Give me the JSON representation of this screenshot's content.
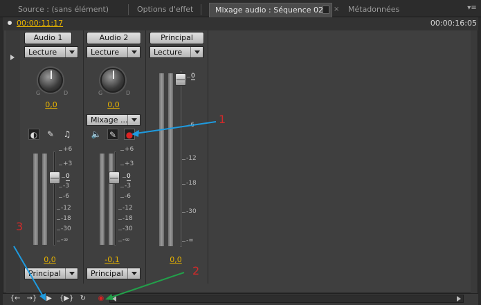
{
  "tabs": [
    {
      "label": "Source : (sans élément)"
    },
    {
      "label": "Options d'effet"
    },
    {
      "label": "Mixage audio : Séquence 02"
    },
    {
      "label": "Métadonnées"
    }
  ],
  "timecode": {
    "current": "00:00:11:17",
    "duration": "00:00:16:05"
  },
  "channels": [
    {
      "name": "Audio 1",
      "mode": "Lecture",
      "knob_left": "G",
      "knob_right": "D",
      "pan_value": "0,0",
      "volume_value": "0,0",
      "output": "Principal"
    },
    {
      "name": "Audio 2",
      "mode": "Lecture",
      "knob_left": "G",
      "knob_right": "D",
      "pan_value": "0,0",
      "effect_dropdown": "Mixage ...",
      "volume_value": "-0,1",
      "output": "Principal"
    },
    {
      "name": "Principal",
      "mode": "Lecture",
      "volume_value": "0,0"
    }
  ],
  "scale_small": [
    "+6",
    "+3",
    "0",
    "-3",
    "-6",
    "-12",
    "-18",
    "-30",
    "-∞"
  ],
  "scale_master": [
    "0",
    "-6",
    "-12",
    "-18",
    "-30",
    "-∞"
  ],
  "annotations": {
    "n1": "1",
    "n2": "2",
    "n3": "3"
  },
  "colors": {
    "accent_time": "#e8b400",
    "record": "#d22222",
    "arrow_blue": "#1e9be0",
    "arrow_green": "#22a04a",
    "annotation_red": "#d12a2a"
  },
  "icons": [
    "mute-icon",
    "solo-icon",
    "record-enable-icon",
    "speaker-icon",
    "pencil-icon",
    "record-icon",
    "go-to-in-icon",
    "go-to-out-icon",
    "play-icon",
    "play-in-to-out-icon",
    "loop-icon",
    "record-button-icon"
  ]
}
